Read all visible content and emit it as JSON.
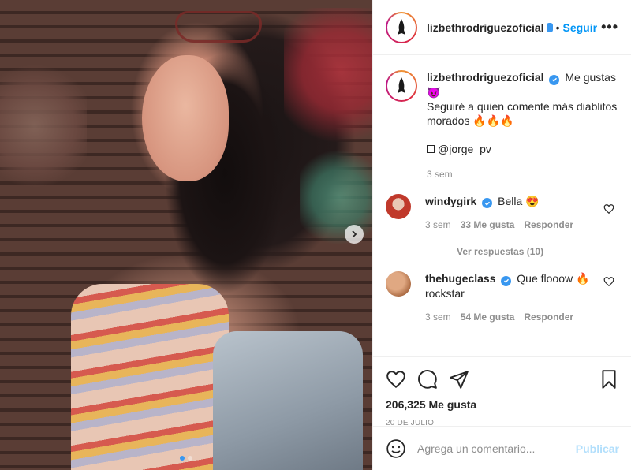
{
  "post": {
    "username": "lizbethrodriguezoficial",
    "header_separator": "•",
    "follow_label": "Seguir",
    "more_label": "•••"
  },
  "caption": {
    "username": "lizbethrodriguezoficial",
    "line1": "Me gustas",
    "line1_emoji": "😈",
    "line2": "Seguiré a quien comente más diablitos morados",
    "line2_emoji": "🔥🔥🔥",
    "tag": "@jorge_pv",
    "time": "3 sem"
  },
  "comments": [
    {
      "username": "windygirk",
      "text": "Bella",
      "emoji": "😍",
      "time": "3 sem",
      "likes": "33 Me gusta",
      "reply_label": "Responder",
      "avatar_color": "#c0392b"
    },
    {
      "username": "thehugeclass",
      "text": "Que flooow",
      "emoji": "🔥",
      "text2": "rockstar",
      "time": "3 sem",
      "likes": "54 Me gusta",
      "reply_label": "Responder",
      "avatar_color": "#c98a5e"
    }
  ],
  "replies_label": "Ver respuestas (10)",
  "stats": {
    "likes": "206,325 Me gusta",
    "date": "20 DE JULIO"
  },
  "composer": {
    "placeholder": "Agrega un comentario...",
    "post_label": "Publicar"
  },
  "colors": {
    "accent": "#0095f6",
    "verified": "#3897f0",
    "muted": "#8e8e8e"
  },
  "icons": [
    "chevron-right-icon",
    "heart-icon",
    "comment-icon",
    "share-icon",
    "bookmark-icon",
    "emoji-icon",
    "verified-icon"
  ]
}
